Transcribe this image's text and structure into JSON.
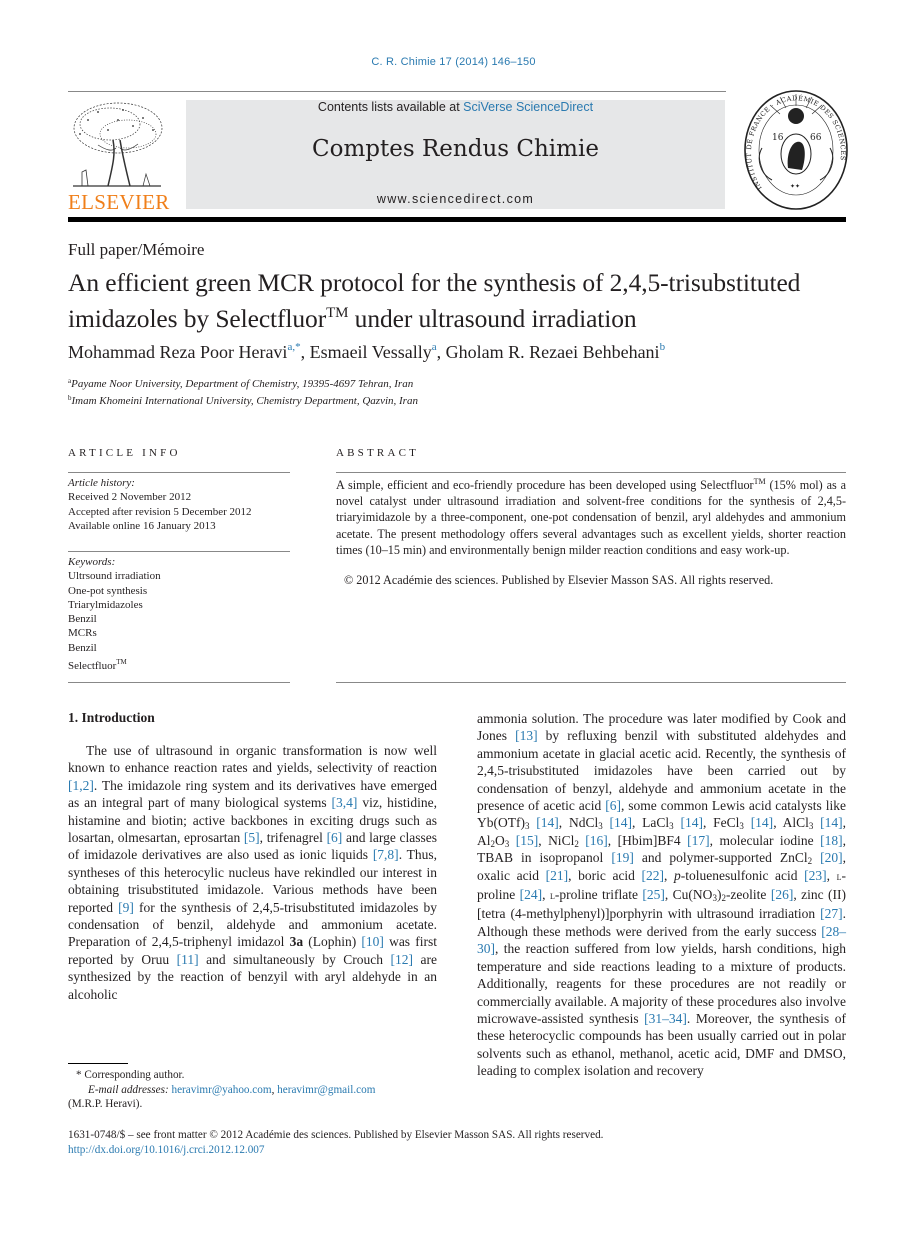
{
  "journal_ref": "C. R. Chimie 17 (2014) 146–150",
  "header": {
    "publisher_logo": "ELSEVIER",
    "contents_prefix": "Contents lists available at ",
    "contents_link": "SciVerse ScienceDirect",
    "journal_title": "Comptes Rendus Chimie",
    "journal_url": "www.sciencedirect.com",
    "seal_icon": "academie-des-sciences-seal",
    "tree_icon": "elsevier-tree-logo"
  },
  "article": {
    "section_type": "Full paper/Mémoire",
    "title_line1": "An efficient green MCR protocol for the synthesis of 2,4,5-trisubstituted",
    "title_line2_pre": "imidazoles by Selectfluor",
    "title_tm": "TM",
    "title_line2_post": " under ultrasound irradiation",
    "authors": [
      {
        "name": "Mohammad Reza Poor Heravi",
        "affil": "a,*"
      },
      {
        "name": "Esmaeil Vessally",
        "affil": "a"
      },
      {
        "name": "Gholam R. Rezaei Behbehani",
        "affil": "b"
      }
    ],
    "affiliations": [
      {
        "mark": "a",
        "text": "Payame Noor University, Department of Chemistry, 19395-4697 Tehran, Iran"
      },
      {
        "mark": "b",
        "text": "Imam Khomeini International University, Chemistry Department, Qazvin, Iran"
      }
    ]
  },
  "article_info": {
    "heading": "ARTICLE INFO",
    "history_label": "Article history:",
    "history": [
      "Received 2 November 2012",
      "Accepted after revision 5 December 2012",
      "Available online 16 January 2013"
    ],
    "keywords_label": "Keywords:",
    "keywords": [
      "Ultrsound irradiation",
      "One-pot synthesis",
      "Triarylmidazoles",
      "Benzil",
      "MCRs",
      "Benzil",
      "Selectfluor"
    ],
    "keyword_tm": "TM"
  },
  "abstract": {
    "heading": "ABSTRACT",
    "text_pre": "A simple, efficient and eco-friendly procedure has been developed using Selectfluor",
    "tm": "TM",
    "text_post": " (15% mol) as a novel catalyst under ultrasound irradiation and solvent-free conditions for the synthesis of 2,4,5-triaryimidazole by a three-component, one-pot condensation of benzil, aryl aldehydes and ammonium acetate. The present methodology offers several advantages such as excellent yields, shorter reaction times (10–15 min) and environmentally benign milder reaction conditions and easy work-up.",
    "copyright": "© 2012 Académie des sciences. Published by Elsevier Masson SAS. All rights reserved."
  },
  "introduction": {
    "heading": "1.  Introduction",
    "refs": {
      "r1": "[1,2]",
      "r2": "[3,4]",
      "r3": "[5]",
      "r4": "[6]",
      "r5": "[7,8]",
      "r6": "[9]",
      "r7": "[10]",
      "r8": "[11]",
      "r9": "[12]",
      "r10": "[13]",
      "r11": "[6]",
      "r12": "[14]",
      "r13": "[14]",
      "r14": "[14]",
      "r15": "[14]",
      "r16": "[14]",
      "r17": "[15]",
      "r18": "[16]",
      "r19": "[17]",
      "r20": "[18]",
      "r21": "[19]",
      "r22": "[20]",
      "r23": "[21]",
      "r24": "[22]",
      "r25": "[23]",
      "r26": "[24]",
      "r27": "[25]",
      "r28": "[26]",
      "r29": "[27]",
      "r30": "[28–30]",
      "r31": "[31–34]"
    },
    "t": {
      "a1": "The use of ultrasound in organic transformation is now well known to enhance reaction rates and yields, selectivity of reaction ",
      "a2": ". The imidazole ring system and its derivatives have emerged as an integral part of many biological systems ",
      "a3": " viz, histidine, histamine and biotin; active backbones in exciting drugs such as losartan, olmesartan, eprosartan ",
      "a4": ", trifenagrel ",
      "a5": " and large classes of imidazole derivatives are also used as ionic liquids ",
      "a6": ". Thus, syntheses of this heterocylic nucleus have rekindled our interest in obtaining trisubstituted imidazole. Various methods have been reported ",
      "a7": " for the synthesis of 2,4,5-trisubstituted imidazoles by condensation of benzil, aldehyde and ammonium acetate. Preparation of 2,4,5-triphenyl imidazol ",
      "a7b": "3a",
      "a8": " (Lophin) ",
      "a9": " was first reported by Oruu ",
      "a10": " and simultaneously by Crouch ",
      "a11": " are synthesized by the reaction of benzyil with aryl aldehyde in an alcoholic ammonia solution. The procedure was later modified by Cook and Jones ",
      "a12": " by refluxing benzil with substituted aldehydes and ammonium acetate in glacial acetic acid. Recently, the synthesis of 2,4,5-trisubstituted imidazoles have been carried out by condensation of benzyl, aldehyde and ammonium acetate in the presence of acetic acid ",
      "a13": ", some common Lewis acid catalysts like Yb(OTf)",
      "a14": ", NdCl",
      "a15": ", LaCl",
      "a16": ", FeCl",
      "a17": ", AlCl",
      "a18": ", Al",
      "a18b": "O",
      "a19": ", NiCl",
      "a20": ", [Hbim]BF4 ",
      "a21": ", molecular iodine ",
      "a22": ", TBAB in isopropanol ",
      "a23": " and polymer-supported ZnCl",
      "a24": ", oxalic acid ",
      "a25": ", boric acid ",
      "a26": ", ",
      "a26i": "p",
      "a26b": "-toluenesulfonic acid ",
      "a27": ", ",
      "a27sc": "l",
      "a27b": "-proline ",
      "a28": ", ",
      "a28sc": "l",
      "a28b": "-proline triflate ",
      "a29": ", Cu(NO",
      "a29b": ")",
      "a29c": "-zeolite ",
      "a30": ", zinc (II) [tetra (4-methylphenyl)]porphyrin with ultrasound irradiation ",
      "a31": ". Although these methods were derived from the early success ",
      "a32": ", the reaction suffered from low yields, harsh conditions, high temperature and side reactions leading to a mixture of products. Additionally, reagents for these procedures are not readily or commercially available. A majority of these procedures also involve microwave-assisted synthesis ",
      "a33": ". Moreover, the synthesis of these heterocyclic compounds has been usually carried out in polar solvents such as ethanol, methanol, acetic acid, DMF and DMSO, leading to complex isolation and recovery"
    },
    "subs": {
      "three": "3",
      "two": "2"
    }
  },
  "footnote": {
    "corresponding": "* Corresponding author.",
    "email_label": "E-mail addresses:",
    "email1": "heravimr@yahoo.com",
    "email_sep": ", ",
    "email2": "heravimr@gmail.com",
    "name": "(M.R.P. Heravi)."
  },
  "front_matter": {
    "issn_line": "1631-0748/$ – see front matter © 2012 Académie des sciences. Published by Elsevier Masson SAS. All rights reserved.",
    "doi": "http://dx.doi.org/10.1016/j.crci.2012.12.007"
  },
  "colors": {
    "link": "#2a7ab0",
    "elsevier_orange": "#f07f1a",
    "banner_bg": "#e6e7e8"
  }
}
